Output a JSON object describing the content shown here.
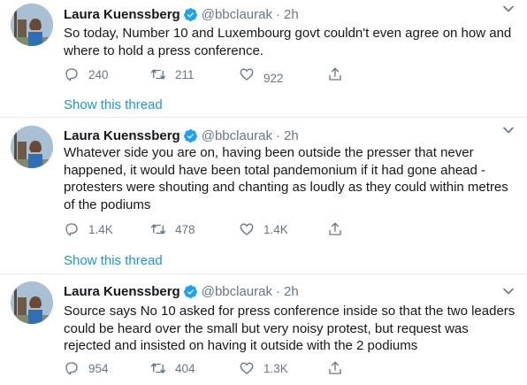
{
  "tweets": [
    {
      "name": "Laura Kuenssberg",
      "handle": "@bbclaurak",
      "separator": "·",
      "time": "2h",
      "text": "So today, Number 10 and Luxembourg govt couldn't even agree on how and\nwhere to hold a press conference.",
      "replies": "240",
      "retweets": "211",
      "likes": "922",
      "show_thread": "Show this thread"
    },
    {
      "name": "Laura Kuenssberg",
      "handle": "@bbclaurak",
      "separator": "·",
      "time": "2h",
      "text": "Whatever side you are on, having been outside the presser that never\nhappened, it would have been total pandemonium if it had gone ahead -\nprotesters were shouting and chanting as loudly as they could within metres\nof the podiums",
      "replies": "1.4K",
      "retweets": "478",
      "likes": "1.4K",
      "show_thread": "Show this thread"
    },
    {
      "name": "Laura Kuenssberg",
      "handle": "@bbclaurak",
      "separator": "·",
      "time": "2h",
      "text": "Source says No 10 asked for press conference inside so that the two leaders\ncould be heard over the small but very noisy protest, but request was\nrejected and insisted on having it outside with the 2 podiums",
      "replies": "954",
      "retweets": "404",
      "likes": "1.3K"
    }
  ],
  "colors": {
    "verified": "#1da1f2",
    "link": "#1b95e0",
    "muted": "#657786"
  }
}
